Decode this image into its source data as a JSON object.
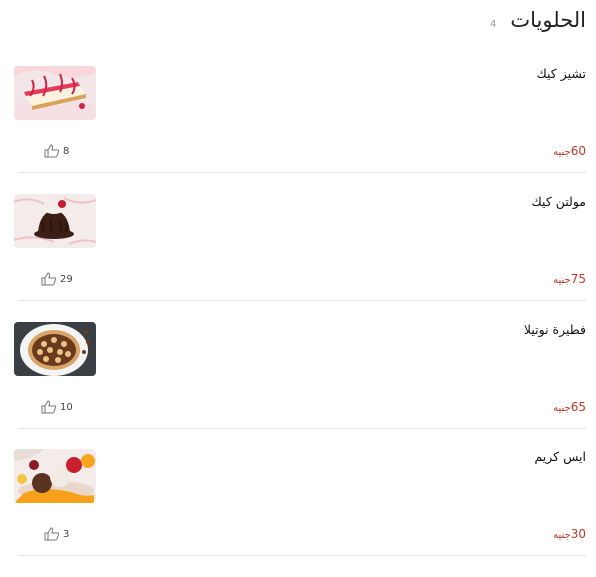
{
  "header": {
    "title": "الحلويات",
    "count": "4"
  },
  "items": [
    {
      "name": "تشيز كيك",
      "price": "60",
      "currency": "جنيه",
      "likes": "8",
      "image": "cheesecake-photo"
    },
    {
      "name": "مولتن كيك",
      "price": "75",
      "currency": "جنيه",
      "likes": "29",
      "image": "molten-cake-photo"
    },
    {
      "name": "فطيرة نوتيلا",
      "price": "65",
      "currency": "جنيه",
      "likes": "10",
      "image": "nutella-pie-photo"
    },
    {
      "name": "ايس كريم",
      "price": "30",
      "currency": "جنيه",
      "likes": "3",
      "image": "ice-cream-photo"
    }
  ],
  "icons": {
    "like": "thumbs-up-icon"
  }
}
